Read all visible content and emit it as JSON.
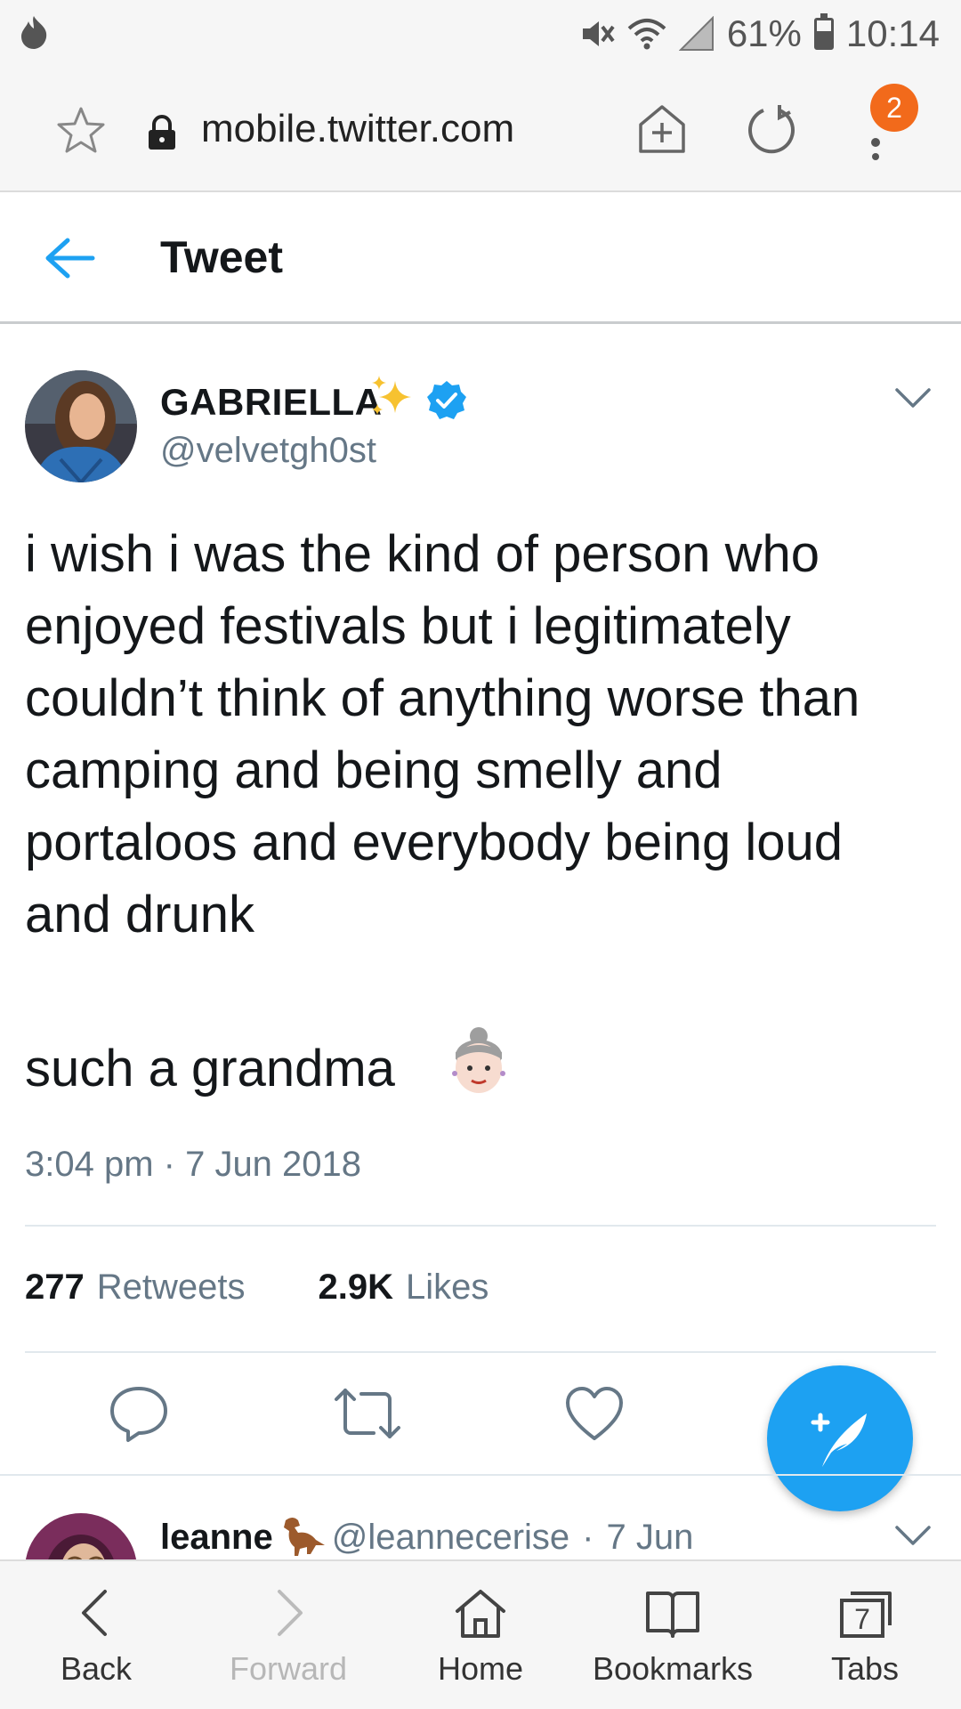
{
  "status_bar": {
    "battery": "61%",
    "battery_level": 0.61,
    "time": "10:14"
  },
  "browser": {
    "url": "mobile.twitter.com",
    "menu_badge": "2"
  },
  "header": {
    "title": "Tweet"
  },
  "tweet": {
    "author_name": "GABRIELLA",
    "author_handle": "@velvetgh0st",
    "text": "i wish i was the kind of person who enjoyed festivals but i legitimately couldn’t think of anything worse than camping and being smelly and portaloos and everybody being loud and drunk",
    "text_line2": "such a grandma",
    "timestamp": "3:04 pm · 7 Jun 2018",
    "retweets_count": "277",
    "retweets_label": "Retweets",
    "likes_count": "2.9K",
    "likes_label": "Likes"
  },
  "next_tweet": {
    "author_name": "leanne",
    "author_handle": "@leannecerise",
    "separator": "·",
    "date": "7 Jun"
  },
  "bottom_nav": {
    "back": "Back",
    "forward": "Forward",
    "home": "Home",
    "bookmarks": "Bookmarks",
    "tabs": "Tabs",
    "tabs_count": "7"
  },
  "colors": {
    "twitter_blue": "#1da1f2",
    "secondary_text": "#657786",
    "badge_orange": "#f26a1b"
  }
}
